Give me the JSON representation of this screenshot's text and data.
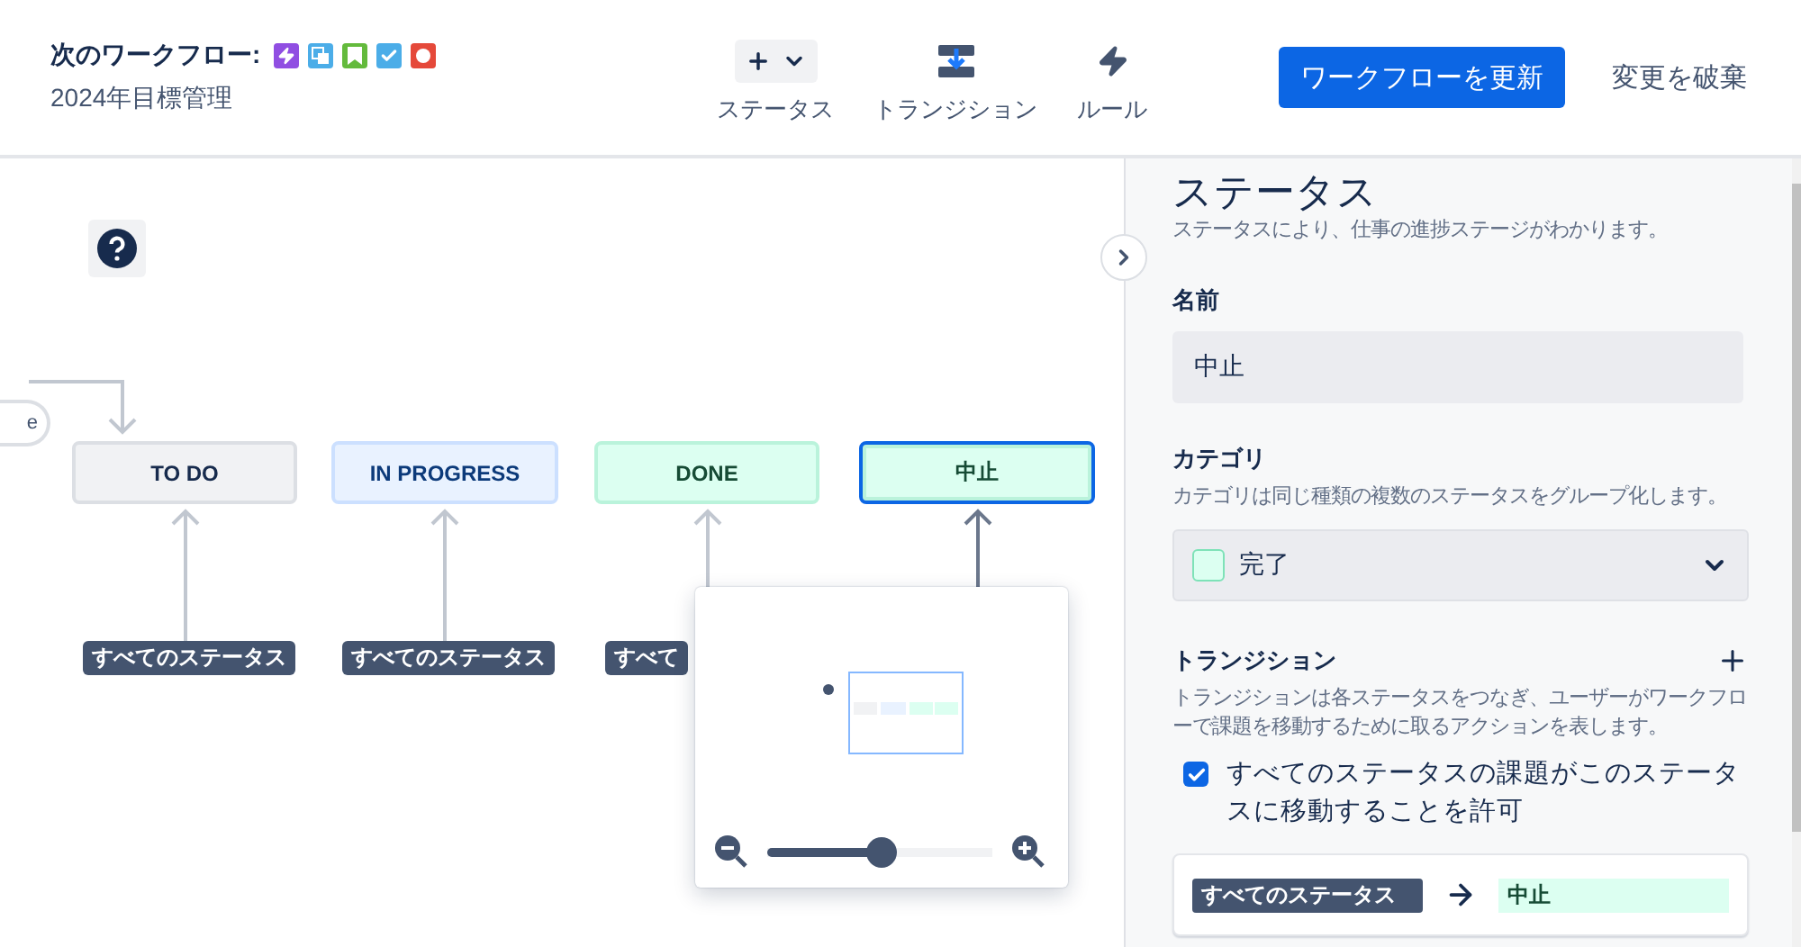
{
  "header": {
    "title": "次のワークフロー:",
    "issue_types": [
      {
        "kind": "epic",
        "color": "#904ee2"
      },
      {
        "kind": "subtask",
        "color": "#4bade8"
      },
      {
        "kind": "story",
        "color": "#63ba3c"
      },
      {
        "kind": "task",
        "color": "#4bade8"
      },
      {
        "kind": "bug",
        "color": "#e5493a"
      }
    ],
    "subtitle": "2024年目標管理"
  },
  "toolbar": [
    {
      "kind": "add",
      "label": "ステータス"
    },
    {
      "kind": "transition",
      "label": "トランジション"
    },
    {
      "kind": "rule",
      "label": "ルール"
    }
  ],
  "actions": {
    "primary": "ワークフローを更新",
    "secondary": "変更を破棄"
  },
  "canvas": {
    "start_label": "e",
    "statuses": [
      {
        "name": "TO DO",
        "kind": "todo",
        "selected": false,
        "from_label": "すべてのステータス"
      },
      {
        "name": "IN PROGRESS",
        "kind": "inprogress",
        "selected": false,
        "from_label": "すべてのステータス"
      },
      {
        "name": "DONE",
        "kind": "done",
        "selected": false,
        "from_label": "すべて"
      },
      {
        "name": "中止",
        "kind": "done",
        "selected": true
      }
    ],
    "minimap": {
      "zoom": {
        "level": 0.5
      }
    }
  },
  "panel": {
    "title": "ステータス",
    "description": "ステータスにより、仕事の進捗ステージがわかります。",
    "name_label": "名前",
    "name_value": "中止",
    "category_label": "カテゴリ",
    "category_description": "カテゴリは同じ種類の複数のステータスをグループ化します。",
    "category": {
      "kind": "done",
      "value": "完了"
    },
    "transitions": {
      "label": "トランジション",
      "description": "トランジションは各ステータスをつなぎ、ユーザーがワークフローで課題を移動するために取るアクションを表します。",
      "allow_all": {
        "checked": true,
        "label": "すべてのステータスの課題がこのステータスに移動することを許可"
      },
      "items": [
        {
          "from": "すべてのステータス",
          "to": {
            "kind": "done",
            "label": "中止"
          }
        }
      ]
    }
  }
}
